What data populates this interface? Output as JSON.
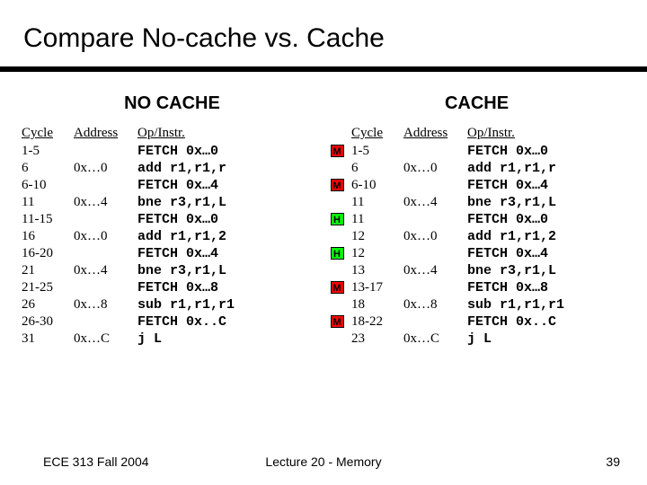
{
  "title": "Compare No-cache vs. Cache",
  "headings": {
    "nocache": "NO CACHE",
    "cache": "CACHE",
    "cycle": "Cycle",
    "address": "Address",
    "opinstr": "Op/Instr."
  },
  "nocache_rows": [
    {
      "cycle": "1-5",
      "addr": "",
      "instr": "FETCH 0x…0"
    },
    {
      "cycle": "6",
      "addr": "0x…0",
      "instr": "add r1,r1,r"
    },
    {
      "cycle": "6-10",
      "addr": "",
      "instr": "FETCH 0x…4"
    },
    {
      "cycle": "11",
      "addr": "0x…4",
      "instr": "bne r3,r1,L"
    },
    {
      "cycle": "11-15",
      "addr": "",
      "instr": "FETCH 0x…0"
    },
    {
      "cycle": "16",
      "addr": "0x…0",
      "instr": "add r1,r1,2"
    },
    {
      "cycle": "16-20",
      "addr": "",
      "instr": "FETCH 0x…4"
    },
    {
      "cycle": "21",
      "addr": "0x…4",
      "instr": "bne r3,r1,L"
    },
    {
      "cycle": "21-25",
      "addr": "",
      "instr": "FETCH 0x…8"
    },
    {
      "cycle": "26",
      "addr": "0x…8",
      "instr": "sub r1,r1,r1"
    },
    {
      "cycle": "26-30",
      "addr": "",
      "instr": "FETCH 0x..C"
    },
    {
      "cycle": "31",
      "addr": "0x…C",
      "instr": "j L"
    }
  ],
  "cache_rows": [
    {
      "mh": "M",
      "cycle": "1-5",
      "addr": "",
      "instr": "FETCH 0x…0"
    },
    {
      "mh": "",
      "cycle": "6",
      "addr": "0x…0",
      "instr": "add r1,r1,r"
    },
    {
      "mh": "M",
      "cycle": "6-10",
      "addr": "",
      "instr": "FETCH 0x…4"
    },
    {
      "mh": "",
      "cycle": "11",
      "addr": "0x…4",
      "instr": "bne r3,r1,L"
    },
    {
      "mh": "H",
      "cycle": "11",
      "addr": "",
      "instr": "FETCH 0x…0"
    },
    {
      "mh": "",
      "cycle": "12",
      "addr": "0x…0",
      "instr": "add r1,r1,2"
    },
    {
      "mh": "H",
      "cycle": "12",
      "addr": "",
      "instr": "FETCH 0x…4"
    },
    {
      "mh": "",
      "cycle": "13",
      "addr": "0x…4",
      "instr": "bne r3,r1,L"
    },
    {
      "mh": "M",
      "cycle": "13-17",
      "addr": "",
      "instr": "FETCH 0x…8"
    },
    {
      "mh": "",
      "cycle": "18",
      "addr": "0x…8",
      "instr": "sub r1,r1,r1"
    },
    {
      "mh": "M",
      "cycle": "18-22",
      "addr": "",
      "instr": "FETCH 0x..C"
    },
    {
      "mh": "",
      "cycle": "23",
      "addr": "0x…C",
      "instr": "j L"
    }
  ],
  "footer": {
    "left": "ECE 313 Fall 2004",
    "center": "Lecture 20 - Memory",
    "right": "39"
  }
}
